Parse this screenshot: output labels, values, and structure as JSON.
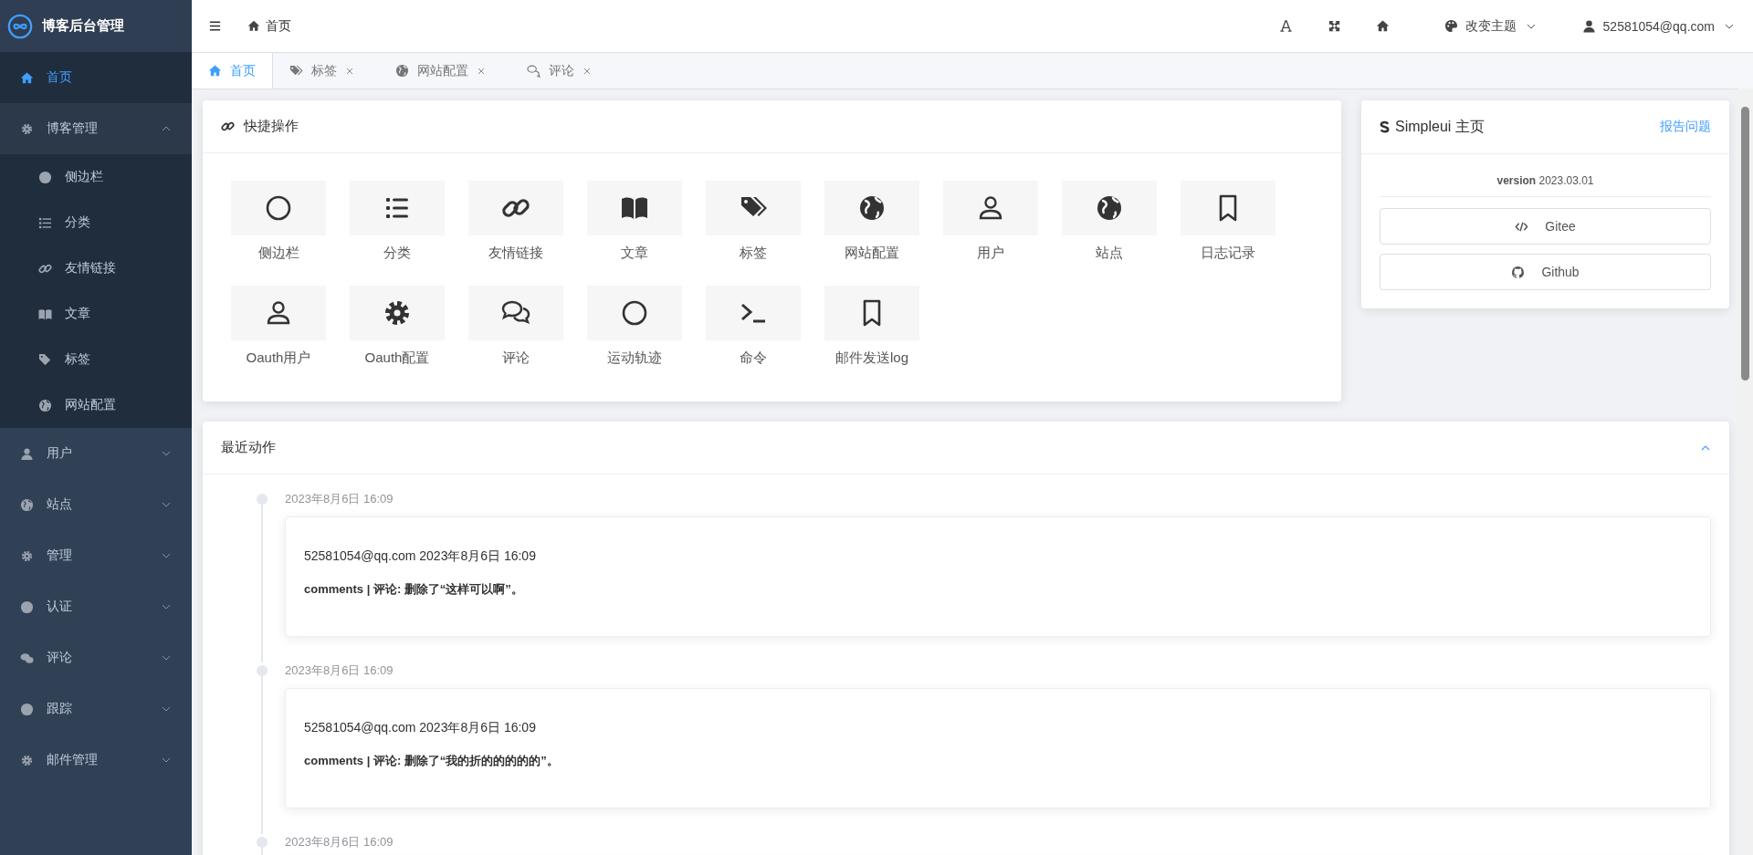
{
  "app": {
    "title": "博客后台管理"
  },
  "sidebar": {
    "items": [
      {
        "label": "首页",
        "selected": true
      },
      {
        "label": "博客管理",
        "selected": false,
        "expanded": true,
        "children": [
          {
            "label": "侧边栏",
            "selected": false
          },
          {
            "label": "分类",
            "selected": false
          },
          {
            "label": "友情链接",
            "selected": false
          },
          {
            "label": "文章",
            "selected": false
          },
          {
            "label": "标签",
            "selected": false
          },
          {
            "label": "网站配置",
            "selected": false
          }
        ]
      },
      {
        "label": "用户",
        "selected": false,
        "expanded": false
      },
      {
        "label": "站点",
        "selected": false,
        "expanded": false
      },
      {
        "label": "管理",
        "selected": false,
        "expanded": false
      },
      {
        "label": "认证",
        "selected": false,
        "expanded": false
      },
      {
        "label": "评论",
        "selected": false,
        "expanded": false
      },
      {
        "label": "跟踪",
        "selected": false,
        "expanded": false
      },
      {
        "label": "邮件管理",
        "selected": false,
        "expanded": false
      }
    ]
  },
  "topbar": {
    "breadcrumb": "首页",
    "theme": "改变主题",
    "user": "52581054@qq.com"
  },
  "tabs": [
    {
      "label": "首页",
      "selected": true,
      "closable": false
    },
    {
      "label": "标签",
      "selected": false,
      "closable": true
    },
    {
      "label": "网站配置",
      "selected": false,
      "closable": true
    },
    {
      "label": "评论",
      "selected": false,
      "closable": true
    }
  ],
  "quick_actions": {
    "title": "快捷操作",
    "items": [
      {
        "label": "侧边栏"
      },
      {
        "label": "分类"
      },
      {
        "label": "友情链接"
      },
      {
        "label": "文章"
      },
      {
        "label": "标签"
      },
      {
        "label": "网站配置"
      },
      {
        "label": "用户"
      },
      {
        "label": "站点"
      },
      {
        "label": "日志记录"
      },
      {
        "label": "Oauth用户"
      },
      {
        "label": "Oauth配置"
      },
      {
        "label": "评论"
      },
      {
        "label": "运动轨迹"
      },
      {
        "label": "命令"
      },
      {
        "label": "邮件发送log"
      }
    ]
  },
  "simpleui": {
    "title": "Simpleui 主页",
    "report": "报告问题",
    "version_label": "version",
    "version": "2023.03.01",
    "buttons": [
      "Gitee",
      "Github"
    ]
  },
  "recent": {
    "title": "最近动作",
    "expanded": true,
    "entries": [
      {
        "time": "2023年8月6日 16:09",
        "lines": [
          "52581054@qq.com 2023年8月6日 16:09",
          "comments | 评论: 删除了“这样可以啊”。"
        ]
      },
      {
        "time": "2023年8月6日 16:09",
        "lines": [
          "52581054@qq.com 2023年8月6日 16:09",
          "comments | 评论: 删除了“我的折的的的的的”。"
        ]
      },
      {
        "time": "2023年8月6日 16:09"
      }
    ]
  }
}
